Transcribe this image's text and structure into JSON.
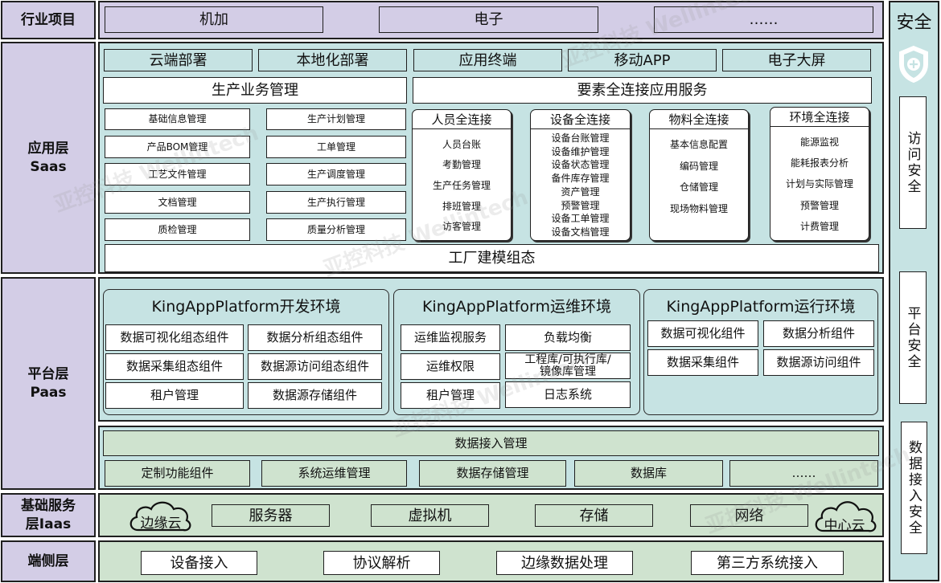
{
  "layers": {
    "industry": "行业项目",
    "app": "应用层\nSaas",
    "platform": "平台层\nPaas",
    "infra": "基础服务\n层Iaas",
    "edge": "端侧层"
  },
  "industry_items": [
    "机加",
    "电子",
    "……"
  ],
  "deploy": [
    "云端部署",
    "本地化部署",
    "应用终端",
    "移动APP",
    "电子大屏"
  ],
  "production": {
    "title": "生产业务管理",
    "left": [
      "基础信息管理",
      "产品BOM管理",
      "工艺文件管理",
      "文档管理",
      "质检管理"
    ],
    "right": [
      "生产计划管理",
      "工单管理",
      "生产调度管理",
      "生产执行管理",
      "质量分析管理"
    ]
  },
  "connect": {
    "title": "要素全连接应用服务",
    "cards": [
      {
        "title": "人员全连接",
        "items": [
          "人员台账",
          "考勤管理",
          "生产任务管理",
          "排班管理",
          "访客管理"
        ]
      },
      {
        "title": "设备全连接",
        "items": [
          "设备台账管理",
          "设备维护管理",
          "设备状态管理",
          "备件库存管理",
          "资产管理",
          "预警管理",
          "设备工单管理",
          "设备文档管理"
        ]
      },
      {
        "title": "物料全连接",
        "items": [
          "基本信息配置",
          "编码管理",
          "仓储管理",
          "现场物料管理"
        ]
      },
      {
        "title": "环境全连接",
        "items": [
          "能源监视",
          "能耗报表分析",
          "计划与实际管理",
          "预警管理",
          "计费管理"
        ]
      }
    ]
  },
  "factory_modeling": "工厂建模组态",
  "platform": {
    "dev": {
      "title": "KingAppPlatform开发环境",
      "items": [
        "数据可视化组态组件",
        "数据分析组态组件",
        "数据采集组态组件",
        "数据源访问组态组件",
        "租户管理",
        "数据源存储组件"
      ]
    },
    "ops": {
      "title": "KingAppPlatform运维环境",
      "items": [
        "运维监视服务",
        "负载均衡",
        "运维权限",
        "工程库/可执行库/\n镜像库管理",
        "租户管理",
        "日志系统"
      ]
    },
    "run": {
      "title": "KingAppPlatform运行环境",
      "items": [
        "数据可视化组件",
        "数据分析组件",
        "数据采集组件",
        "数据源访问组件"
      ]
    }
  },
  "data_access": {
    "title": "数据接入管理",
    "items": [
      "定制功能组件",
      "系统运维管理",
      "数据存储管理",
      "数据库",
      "……"
    ]
  },
  "infra": {
    "edge_cloud": "边缘云",
    "items": [
      "服务器",
      "虚拟机",
      "存储",
      "网络"
    ],
    "center_cloud": "中心云"
  },
  "edge": [
    "设备接入",
    "协议解析",
    "边缘数据处理",
    "第三方系统接入"
  ],
  "security": {
    "title": "安全",
    "icon": "shield-plus-icon",
    "items": [
      "访问安全",
      "平台安全",
      "数据接入安全"
    ]
  },
  "watermark": "亚控科技 Wellintech"
}
